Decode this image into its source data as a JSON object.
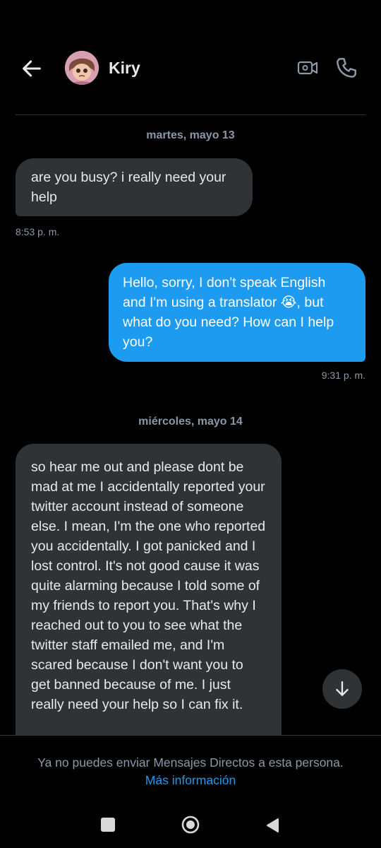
{
  "header": {
    "contact_name": "Kiry",
    "icons": {
      "back": "back-arrow-icon",
      "video": "video-call-icon",
      "call": "phone-call-icon"
    }
  },
  "conversation": [
    {
      "date": "martes, mayo 13"
    },
    {
      "text": "are you busy? i really need your help",
      "time": "8:53 p. m."
    },
    {
      "text": "Hello, sorry, I don't speak English and I'm using a translator 😭, but what do you need? How can I help you?",
      "time": "9:31 p. m."
    },
    {
      "date": "miércoles, mayo 14"
    },
    {
      "text": "so hear me out and please dont be mad at me I accidentally reported your twitter account instead of someone else. I mean, I'm the one who reported you accidentally. I got panicked and I lost control. It's not good cause it was quite alarming because I told some of my friends to report you. That's why I reached out to you to see what the twitter staff emailed me, and I'm scared because I don't want you to get banned because of me. I just really need your help so I can fix it."
    }
  ],
  "scroll_button_icon": "arrow-down-icon",
  "footer": {
    "notice": "Ya no puedes enviar Mensajes Directos a esta persona.",
    "link": "Más información"
  },
  "colors": {
    "accent": "#1d9bf0",
    "incoming_bubble": "#2f3336",
    "background": "#000000",
    "muted_text": "#8b98a5"
  }
}
